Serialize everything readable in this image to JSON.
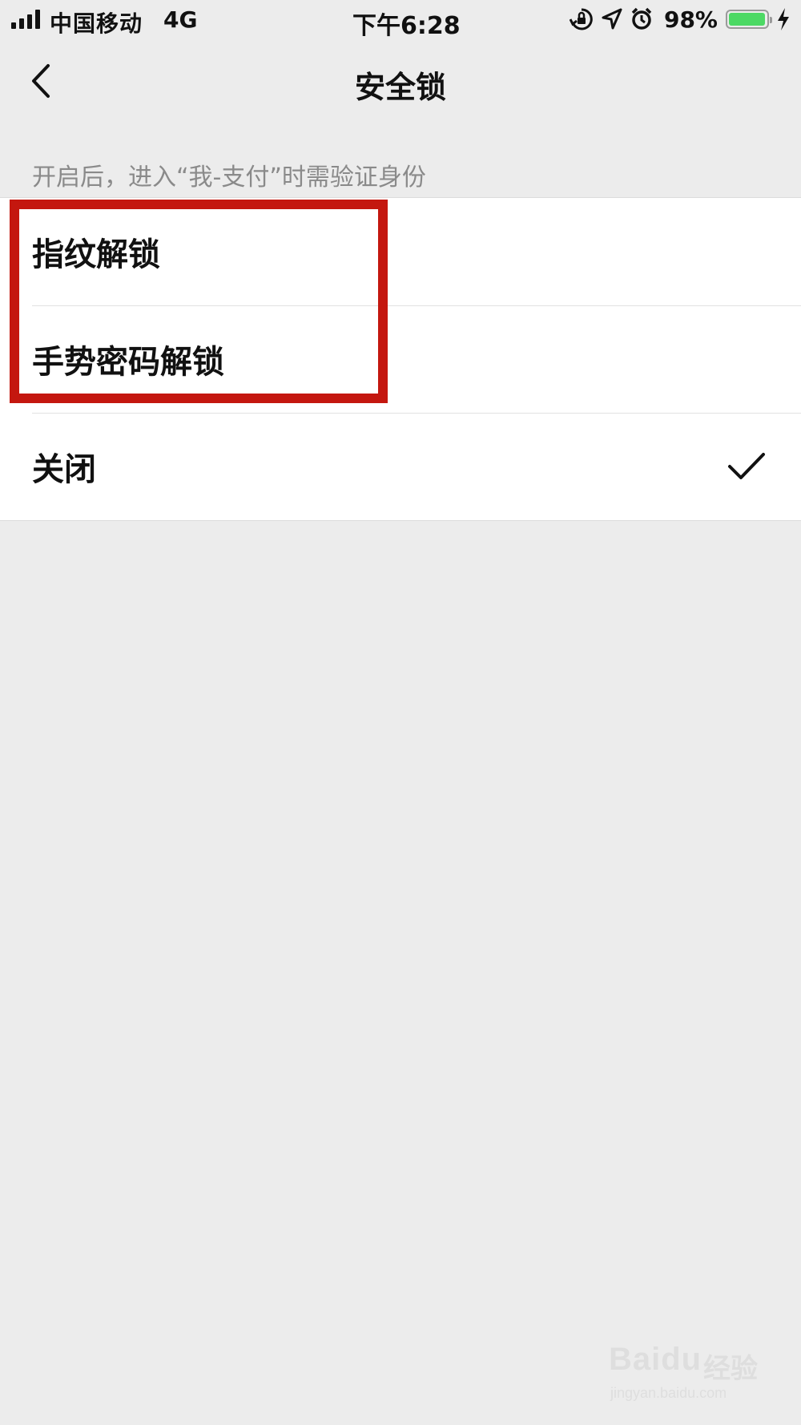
{
  "status_bar": {
    "carrier": "中国移动",
    "network": "4G",
    "time": "下午6:28",
    "battery_percent": "98%",
    "battery_level": 0.98,
    "icons": [
      "signal-icon",
      "orientation-lock-icon",
      "location-icon",
      "alarm-icon",
      "battery-icon",
      "charging-icon"
    ]
  },
  "nav": {
    "title": "安全锁",
    "back_icon": "chevron-left-icon"
  },
  "section": {
    "description": "开启后，进入“我-支付”时需验证身份"
  },
  "options": [
    {
      "label": "指纹解锁",
      "selected": false
    },
    {
      "label": "手势密码解锁",
      "selected": false
    },
    {
      "label": "关闭",
      "selected": true
    }
  ],
  "colors": {
    "background": "#ececec",
    "highlight": "#c4170f",
    "battery": "#4cd964"
  },
  "watermark": {
    "brand": "Baidu",
    "brand_cn": "经验",
    "url": "jingyan.baidu.com"
  }
}
